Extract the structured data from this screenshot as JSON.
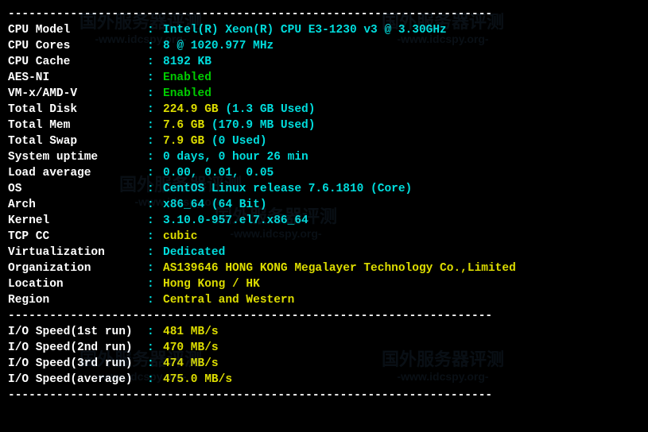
{
  "divider": "----------------------------------------------------------------------",
  "rows": [
    {
      "label": "CPU Model",
      "value": "Intel(R) Xeon(R) CPU E3-1230 v3 @ 3.30GHz",
      "color": "cyan"
    },
    {
      "label": "CPU Cores",
      "value": "8 @ 1020.977 MHz",
      "color": "cyan"
    },
    {
      "label": "CPU Cache",
      "value": "8192 KB",
      "color": "cyan"
    },
    {
      "label": "AES-NI",
      "value": "Enabled",
      "color": "green"
    },
    {
      "label": "VM-x/AMD-V",
      "value": "Enabled",
      "color": "green"
    },
    {
      "label": "Total Disk",
      "value_parts": [
        {
          "t": "224.9 GB ",
          "c": "yellow"
        },
        {
          "t": "(1.3 GB Used)",
          "c": "cyan"
        }
      ]
    },
    {
      "label": "Total Mem",
      "value_parts": [
        {
          "t": "7.6 GB ",
          "c": "yellow"
        },
        {
          "t": "(170.9 MB Used)",
          "c": "cyan"
        }
      ]
    },
    {
      "label": "Total Swap",
      "value_parts": [
        {
          "t": "7.9 GB ",
          "c": "yellow"
        },
        {
          "t": "(0 Used)",
          "c": "cyan"
        }
      ]
    },
    {
      "label": "System uptime",
      "value": "0 days, 0 hour 26 min",
      "color": "cyan"
    },
    {
      "label": "Load average",
      "value": "0.00, 0.01, 0.05",
      "color": "cyan"
    },
    {
      "label": "OS",
      "value": "CentOS Linux release 7.6.1810 (Core)",
      "color": "cyan"
    },
    {
      "label": "Arch",
      "value": "x86_64 (64 Bit)",
      "color": "cyan"
    },
    {
      "label": "Kernel",
      "value": "3.10.0-957.el7.x86_64",
      "color": "cyan"
    },
    {
      "label": "TCP CC",
      "value": "cubic",
      "color": "yellow"
    },
    {
      "label": "Virtualization",
      "value": "Dedicated",
      "color": "cyan"
    },
    {
      "label": "Organization",
      "value": "AS139646 HONG KONG Megalayer Technology Co.,Limited",
      "color": "yellow"
    },
    {
      "label": "Location",
      "value": "Hong Kong / HK",
      "color": "yellow"
    },
    {
      "label": "Region",
      "value": "Central and Western",
      "color": "yellow"
    }
  ],
  "io_rows": [
    {
      "label": "I/O Speed(1st run)",
      "value": "481 MB/s",
      "color": "yellow"
    },
    {
      "label": "I/O Speed(2nd run)",
      "value": "470 MB/s",
      "color": "yellow"
    },
    {
      "label": "I/O Speed(3rd run)",
      "value": "474 MB/s",
      "color": "yellow"
    },
    {
      "label": "I/O Speed(average)",
      "value": "475.0 MB/s",
      "color": "yellow"
    }
  ],
  "watermark": {
    "main": "国外服务器评测",
    "sub": "-www.idcspy.org-"
  }
}
